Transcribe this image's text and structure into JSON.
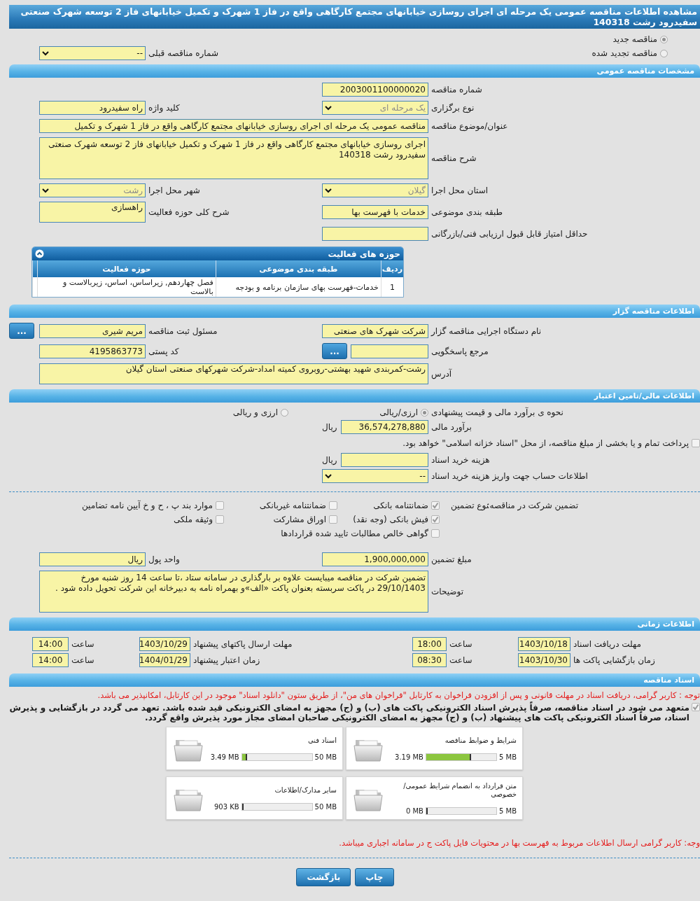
{
  "title": "مشاهده اطلاعات مناقصه عمومی یک مرحله ای اجرای روسازی خیابانهای مجتمع کارگاهی واقع در فاز 1 شهرک و تکمیل خیابانهای فاز 2 توسعه شهرک صنعتی سفیدرود رشت 140318",
  "tender_type": {
    "options": [
      {
        "label": "مناقصه جدید",
        "selected": true
      },
      {
        "label": "مناقصه تجدید شده",
        "selected": false
      }
    ],
    "previous": {
      "label": "شماره مناقصه قبلی",
      "value": "--",
      "kind": "select"
    }
  },
  "general": {
    "header": "مشخصات مناقصه عمومی",
    "rows": [
      {
        "right": {
          "label": "شماره مناقصه",
          "value": "2003001100000020",
          "kind": "text"
        }
      },
      {
        "right": {
          "label": "نوع برگزاری",
          "value": "یک مرحله ای",
          "kind": "select",
          "disabled": true
        },
        "left": {
          "label": "کلید واژه",
          "value": "راه سفیدرود",
          "kind": "text"
        }
      },
      {
        "wide": {
          "label": "عنوان/موضوع مناقصه",
          "value": "مناقصه عمومی یک مرحله ای اجرای روسازی خیابانهای مجتمع کارگاهی واقع در فاز 1 شهرک و تکمیل",
          "kind": "text"
        }
      },
      {
        "wide": {
          "label": "شرح مناقصه",
          "value": "اجرای روسازی خیابانهای مجتمع کارگاهی واقع در فاز 1 شهرک و تکمیل خیابانهای فاز 2 توسعه شهرک صنعتی سفیدرود رشت  140318",
          "kind": "area"
        }
      },
      {
        "right": {
          "label": "استان محل اجرا",
          "value": "گیلان",
          "kind": "select",
          "disabled": true
        },
        "left": {
          "label": "شهر محل اجرا",
          "value": "رشت",
          "kind": "select",
          "disabled": true
        }
      },
      {
        "right": {
          "label": "طبقه بندی موضوعی",
          "value": "خدمات با فهرست بها",
          "kind": "text"
        },
        "left": {
          "label": "شرح کلی حوزه فعالیت",
          "value": "راهسازی",
          "kind": "memo"
        }
      },
      {
        "right": {
          "label": "حداقل امتیاز قابل قبول ارزیابی فنی/بازرگانی",
          "kind": "text"
        }
      }
    ],
    "activities": {
      "title": "حوزه های فعالیت",
      "expanded": true,
      "columns": [
        "ردیف",
        "طبقه بندی موضوعی",
        "حوزه فعالیت"
      ],
      "rows": [
        [
          "1",
          "خدمات-فهرست بهای سازمان برنامه و بودجه",
          "فصل چهاردهم, زیراساس، اساس، زیربالاست  و بالاست"
        ]
      ]
    }
  },
  "employer": {
    "header": "اطلاعات مناقصه گزار",
    "rows": [
      {
        "right": {
          "label": "نام دستگاه اجرایی مناقصه گزار",
          "value": "شرکت شهرک های صنعتی",
          "kind": "text"
        },
        "left": {
          "label": "مسئول ثبت مناقصه",
          "value": "مریم شیری",
          "kind": "text",
          "button": "..."
        }
      },
      {
        "right": {
          "label": "مرجع پاسخگویی",
          "kind": "text",
          "button": "..."
        },
        "left": {
          "label": "کد پستی",
          "value": "4195863773",
          "kind": "text"
        }
      },
      {
        "wide": {
          "label": "آدرس",
          "value": "رشت-کمربندی شهید بهشتی-روبروی کمیته امداد-شرکت شهرکهای صنعتی استان گیلان",
          "kind": "memo"
        }
      }
    ]
  },
  "finance": {
    "header": "اطلاعات مالی/تامین اعتبار",
    "method": {
      "label": "نحوه ی برآورد مالی و قیمت پیشنهادی",
      "options": [
        {
          "label": "ارزی/ریالی",
          "selected": true
        },
        {
          "label": "ارزی و ریالی",
          "selected": false
        }
      ]
    },
    "estimate": [
      {
        "right": {
          "label": "برآورد مالی",
          "value": "36,574,278,880",
          "kind": "text",
          "unit": "ریال"
        }
      }
    ],
    "treasury": {
      "label": "پرداخت تمام و یا بخشی از مبلغ مناقصه، از محل \"اسناد خزانه اسلامی\" خواهد بود.",
      "checked": false
    },
    "rows": [
      {
        "right": {
          "label": "هزینه خرید اسناد",
          "kind": "text",
          "unit": "ریال"
        }
      },
      {
        "right": {
          "label": "اطلاعات حساب جهت واریز هزینه خرید اسناد",
          "value": "--",
          "kind": "select"
        }
      }
    ]
  },
  "guarantee": {
    "label": "تضمین شرکت در مناقصه:",
    "type_label": "نوع تضمین",
    "options": [
      {
        "label": "ضمانتنامه بانکی",
        "checked": true
      },
      {
        "label": "ضمانتنامه غیربانکی",
        "checked": false
      },
      {
        "label": "موارد بند پ ، ح و خ آیین نامه تضامین",
        "checked": false
      },
      {
        "label": "فیش بانکی (وجه نقد)",
        "checked": true
      },
      {
        "label": "اوراق مشارکت",
        "checked": false
      },
      {
        "label": "وثیقه ملکی",
        "checked": false
      },
      {
        "label": "گواهی خالص مطالبات تایید شده قراردادها",
        "checked": false
      }
    ],
    "rows": [
      {
        "right": {
          "label": "مبلغ تضمین",
          "value": "1,900,000,000",
          "kind": "text"
        },
        "left": {
          "label": "واحد پول",
          "value": "ریال",
          "kind": "text"
        }
      },
      {
        "wide": {
          "label": "توضیحات",
          "value": "تضمین شرکت در مناقصه میبایست علاوه بر بارگذاری در سامانه ستاد ،تا ساعت   14 روز شنبه مورخ 29/10/1403  در  پاکت سربسته  بعنوان پاکت  «الف»و بهمراه نامه به دبیرخانه این شرکت تحویل داده شود .",
          "kind": "area"
        }
      }
    ]
  },
  "timing": {
    "header": "اطلاعات زمانی",
    "rows": [
      [
        {
          "label": "مهلت دریافت اسناد",
          "value": "1403/10/18"
        },
        {
          "label": "ساعت",
          "value": "18:00"
        },
        {
          "label": "مهلت ارسال پاکتهای پیشنهاد",
          "value": "1403/10/29"
        },
        {
          "label": "ساعت",
          "value": "14:00"
        }
      ],
      [
        {
          "label": "زمان بازگشایی پاکت ها",
          "value": "1403/10/30"
        },
        {
          "label": "ساعت",
          "value": "08:30"
        },
        {
          "label": "زمان اعتبار پیشنهاد",
          "value": "1404/01/29"
        },
        {
          "label": "ساعت",
          "value": "14:00"
        }
      ]
    ]
  },
  "documents": {
    "header": "اسناد مناقصه",
    "notice": "توجه : کاربر گرامی، دریافت اسناد در مهلت قانونی و پس از افزودن فراخوان به کارتابل \"فراخوان های من\"، از طریق ستون \"دانلود اسناد\" موجود در این کارتابل، امکانپذیر می باشد.",
    "commitment": {
      "text": "متعهد می شود در اسناد مناقصه، صرفاً پذیرش اسناد الکترونیکی پاکت های (ب) و (ج) مجهز به امضای الکترونیکی قید شده باشد. تعهد می گردد در بازگشایی و پذیرش اسناد، صرفاً اسناد الکترونیکی پاکت های پیشنهاد (ب) و (ج) مجهز به امضای الکترونیکی صاحبان امضای مجاز مورد پذیرش واقع گردد.",
      "checked": true
    },
    "files": [
      {
        "title": "شرایط و ضوابط مناقصه",
        "used": "3.19 MB",
        "limit": "5 MB",
        "level": 0.638
      },
      {
        "title": "اسناد فنی",
        "used": "3.49 MB",
        "limit": "50 MB",
        "level": 0.07
      },
      {
        "title": "متن قرارداد به انضمام شرایط عمومی/خصوصی",
        "used": "0 MB",
        "limit": "5 MB",
        "level": 0
      },
      {
        "title": "سایر مدارک/اطلاعات",
        "used": "903 KB",
        "limit": "50 MB",
        "level": 0.018
      }
    ],
    "footnote": "وجه: کاربر گرامی ارسال اطلاعات مربوط به فهرست بها در محتویات فایل پاکت ج در سامانه اجباری میباشد."
  },
  "buttons": [
    "چاپ",
    "بازگشت"
  ]
}
